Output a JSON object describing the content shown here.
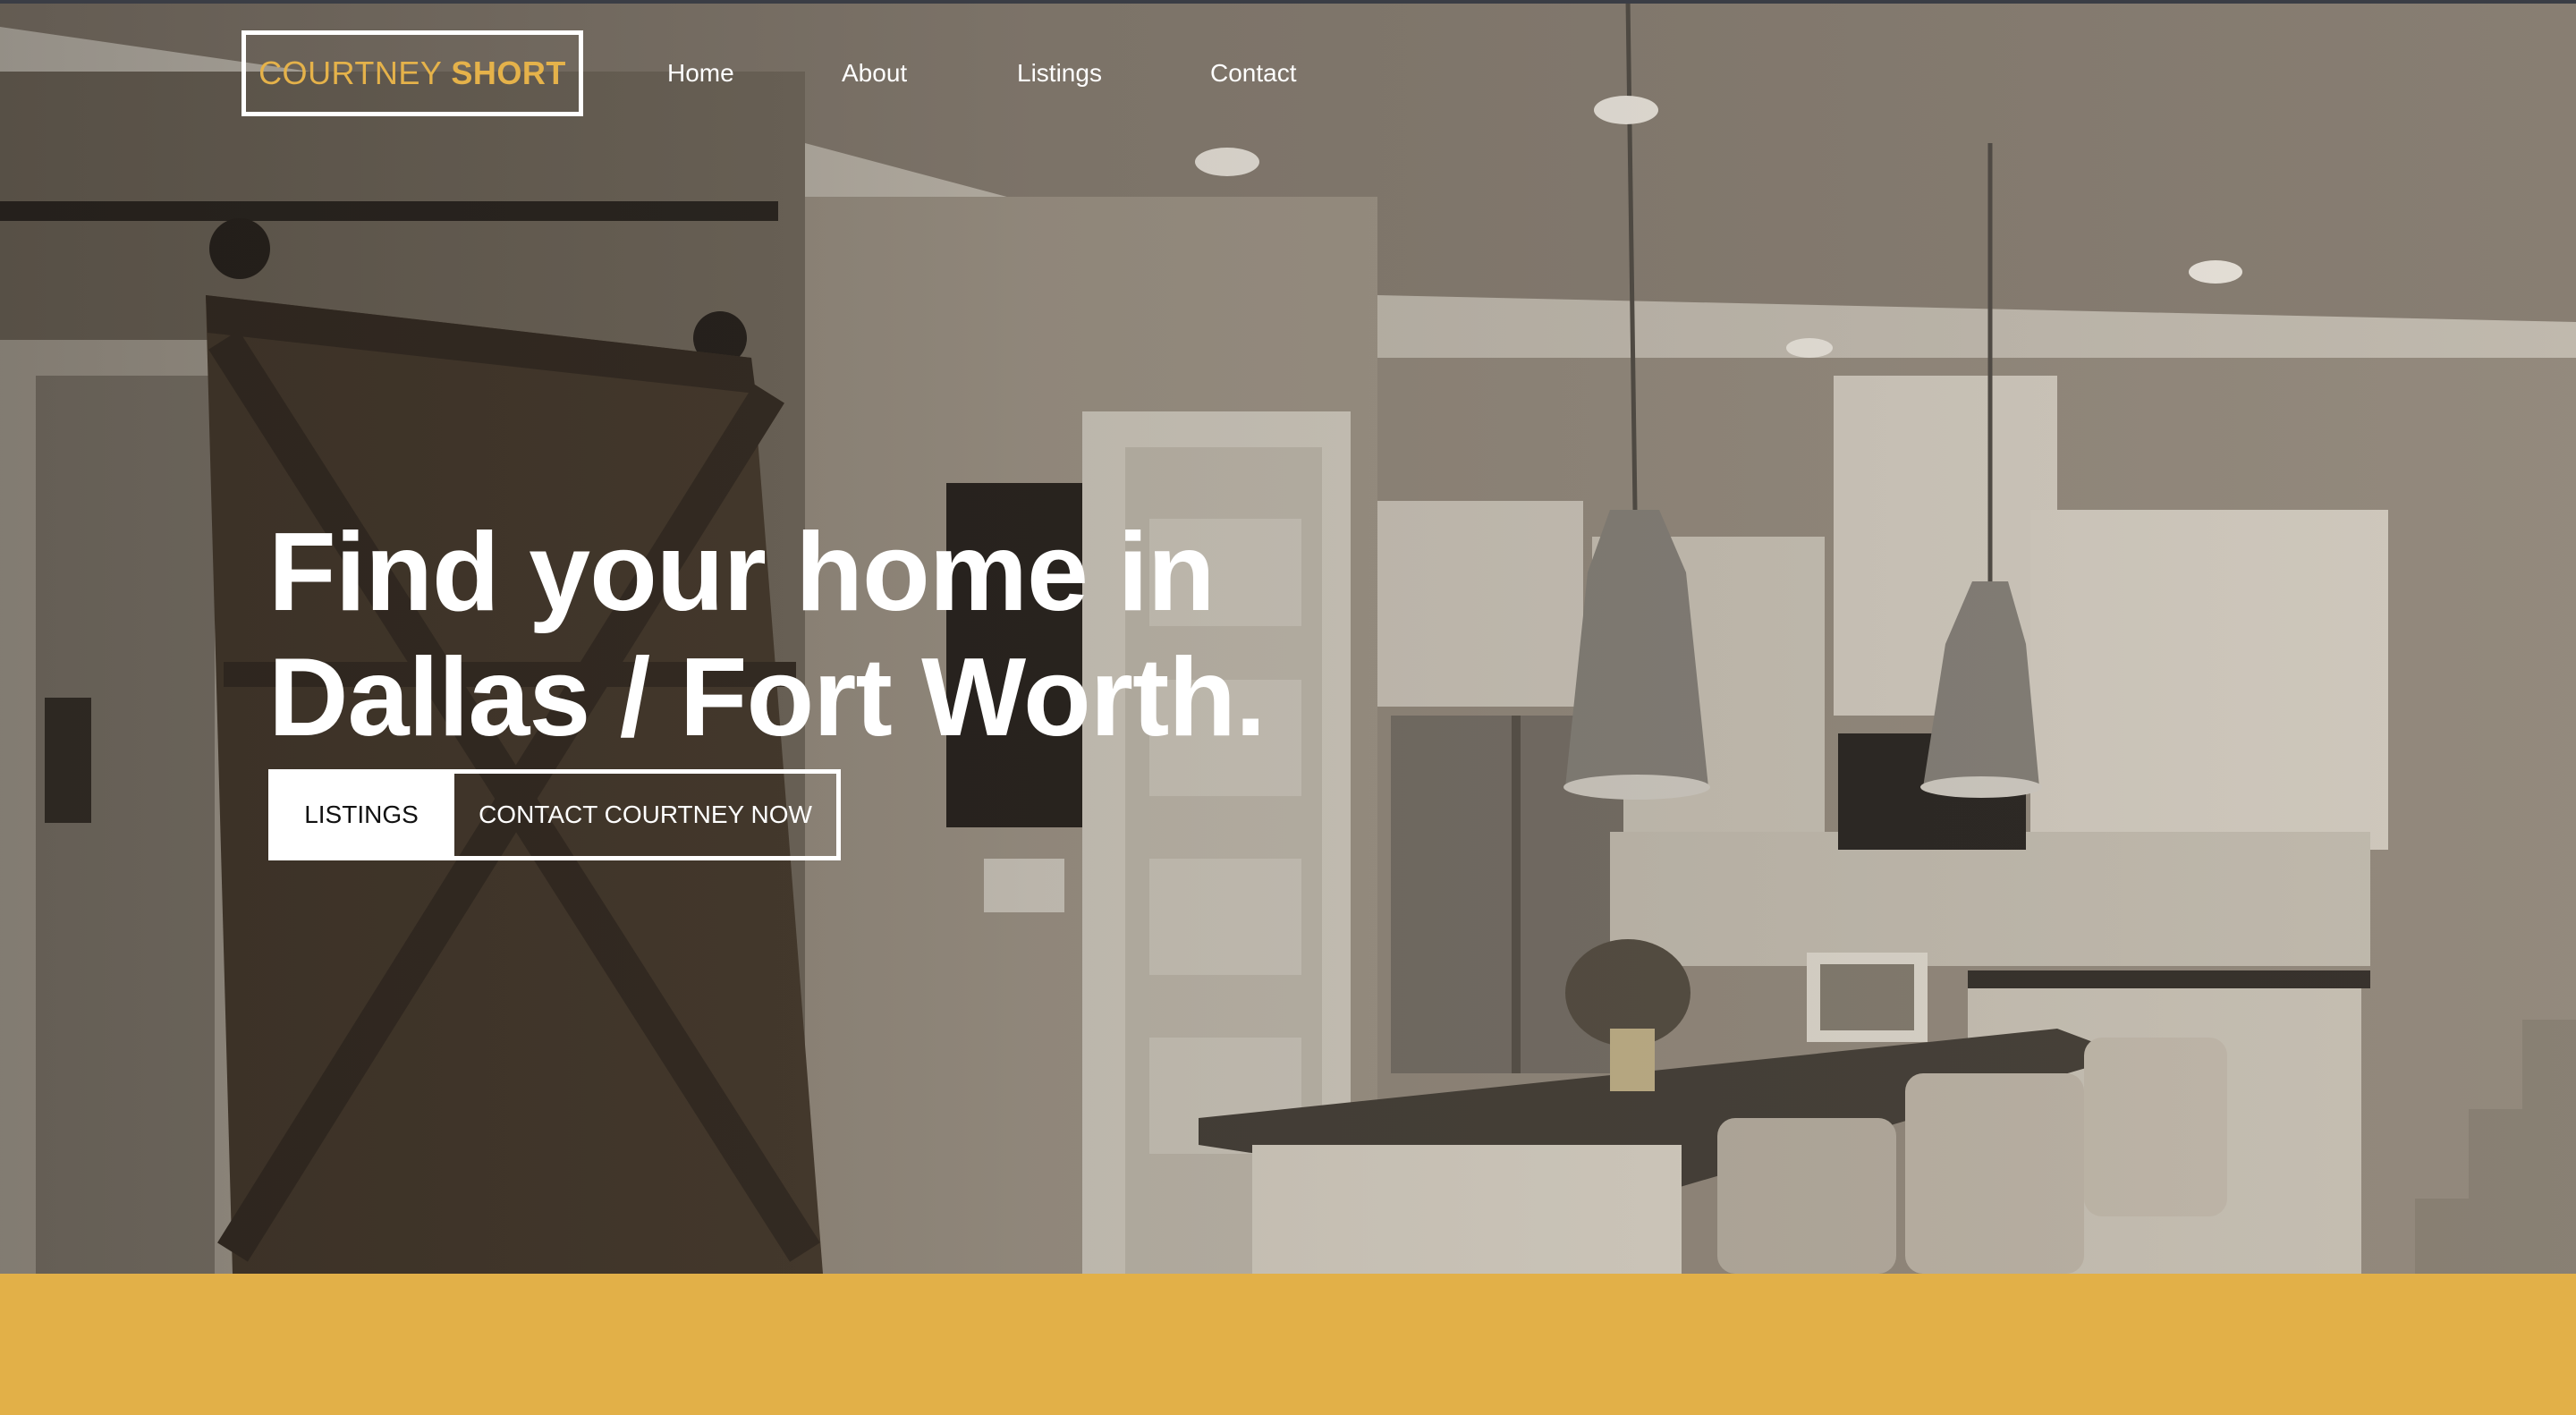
{
  "brand": {
    "first": "COURTNEY",
    "last": "SHORT"
  },
  "nav": {
    "items": [
      {
        "label": "Home"
      },
      {
        "label": "About"
      },
      {
        "label": "Listings"
      },
      {
        "label": "Contact"
      }
    ]
  },
  "hero": {
    "headline_line1": "Find your home in",
    "headline_line2": "Dallas / Fort Worth.",
    "primary_button": "LISTINGS",
    "secondary_button": "CONTACT COURTNEY NOW",
    "background_subject": "sepia-toned kitchen interior with barn door, pendant lights and island"
  },
  "colors": {
    "accent": "#e2b048",
    "logo_text": "#e5b24a",
    "text_light": "#ffffff",
    "button_fill": "#ffffff",
    "button_text": "#111111"
  }
}
